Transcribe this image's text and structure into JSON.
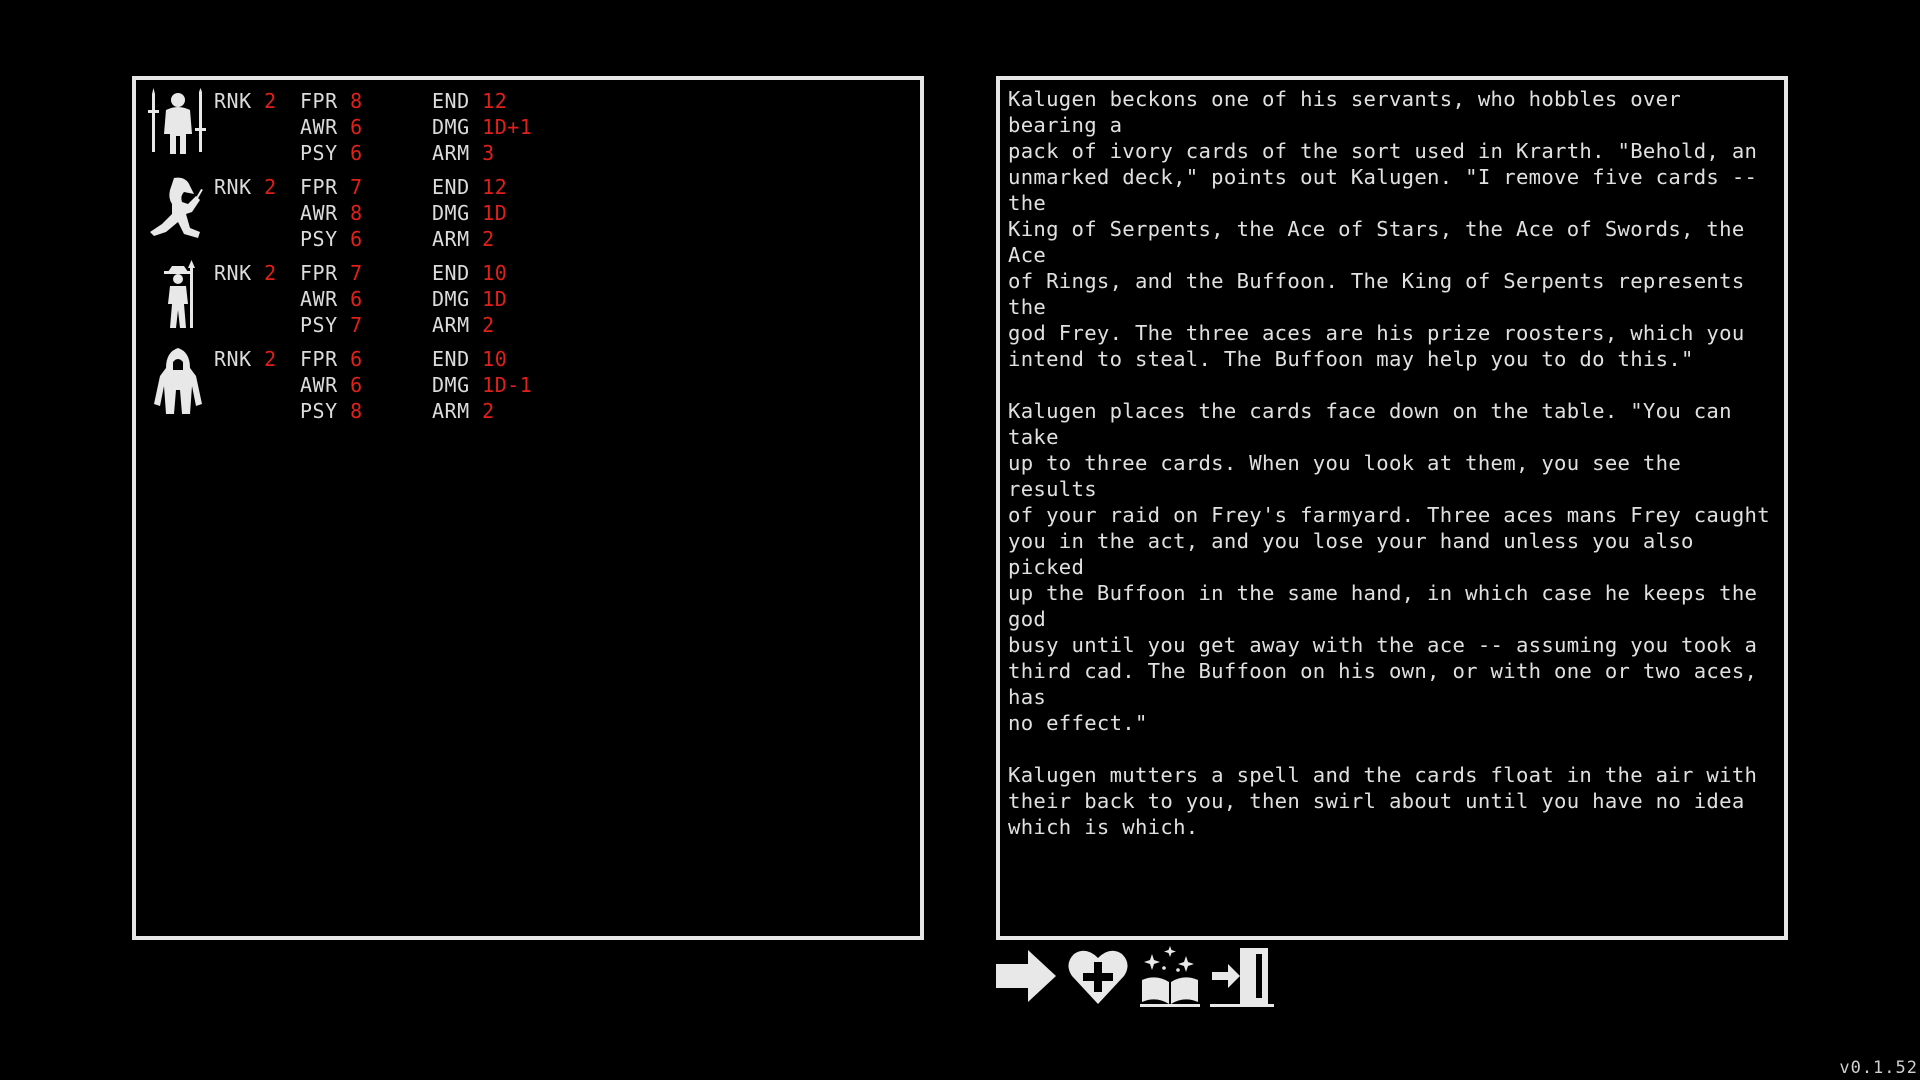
{
  "party": [
    {
      "icon": "warrior-icon",
      "stats": {
        "rnk": {
          "label": "RNK",
          "value": "2"
        },
        "fpr": {
          "label": "FPR",
          "value": "8"
        },
        "awr": {
          "label": "AWR",
          "value": "6"
        },
        "psy": {
          "label": "PSY",
          "value": "6"
        },
        "end": {
          "label": "END",
          "value": "12"
        },
        "dmg": {
          "label": "DMG",
          "value": "1D+1"
        },
        "arm": {
          "label": "ARM",
          "value": "3"
        }
      }
    },
    {
      "icon": "trickster-icon",
      "stats": {
        "rnk": {
          "label": "RNK",
          "value": "2"
        },
        "fpr": {
          "label": "FPR",
          "value": "7"
        },
        "awr": {
          "label": "AWR",
          "value": "8"
        },
        "psy": {
          "label": "PSY",
          "value": "6"
        },
        "end": {
          "label": "END",
          "value": "12"
        },
        "dmg": {
          "label": "DMG",
          "value": "1D"
        },
        "arm": {
          "label": "ARM",
          "value": "2"
        }
      }
    },
    {
      "icon": "sage-icon",
      "stats": {
        "rnk": {
          "label": "RNK",
          "value": "2"
        },
        "fpr": {
          "label": "FPR",
          "value": "7"
        },
        "awr": {
          "label": "AWR",
          "value": "6"
        },
        "psy": {
          "label": "PSY",
          "value": "7"
        },
        "end": {
          "label": "END",
          "value": "10"
        },
        "dmg": {
          "label": "DMG",
          "value": "1D"
        },
        "arm": {
          "label": "ARM",
          "value": "2"
        }
      }
    },
    {
      "icon": "enchanter-icon",
      "stats": {
        "rnk": {
          "label": "RNK",
          "value": "2"
        },
        "fpr": {
          "label": "FPR",
          "value": "6"
        },
        "awr": {
          "label": "AWR",
          "value": "6"
        },
        "psy": {
          "label": "PSY",
          "value": "8"
        },
        "end": {
          "label": "END",
          "value": "10"
        },
        "dmg": {
          "label": "DMG",
          "value": "1D-1"
        },
        "arm": {
          "label": "ARM",
          "value": "2"
        }
      }
    }
  ],
  "story": {
    "text": "Kalugen beckons one of his servants, who hobbles over bearing a\npack of ivory cards of the sort used in Krarth. \"Behold, an\nunmarked deck,\" points out Kalugen. \"I remove five cards -- the\nKing of Serpents, the Ace of Stars, the Ace of Swords, the Ace\nof Rings, and the Buffoon. The King of Serpents represents the\ngod Frey. The three aces are his prize roosters, which you\nintend to steal. The Buffoon may help you to do this.\"\n\nKalugen places the cards face down on the table. \"You can take\nup to three cards. When you look at them, you see the results\nof your raid on Frey's farmyard. Three aces mans Frey caught\nyou in the act, and you lose your hand unless you also picked\nup the Buffoon in the same hand, in which case he keeps the god\nbusy until you get away with the ace -- assuming you took a\nthird cad. The Buffoon on his own, or with one or two aces, has\nno effect.\"\n\nKalugen mutters a spell and the cards float in the air with\ntheir back to you, then swirl about until you have no idea\nwhich is which."
  },
  "actions": [
    {
      "icon": "arrow-right-icon"
    },
    {
      "icon": "heart-plus-icon"
    },
    {
      "icon": "spellbook-icon"
    },
    {
      "icon": "exit-door-icon"
    }
  ],
  "version": "v0.1.52",
  "colors": {
    "background": "#000000",
    "border": "#e6e6e6",
    "label": "#dcdcdc",
    "value": "#e0201a"
  }
}
